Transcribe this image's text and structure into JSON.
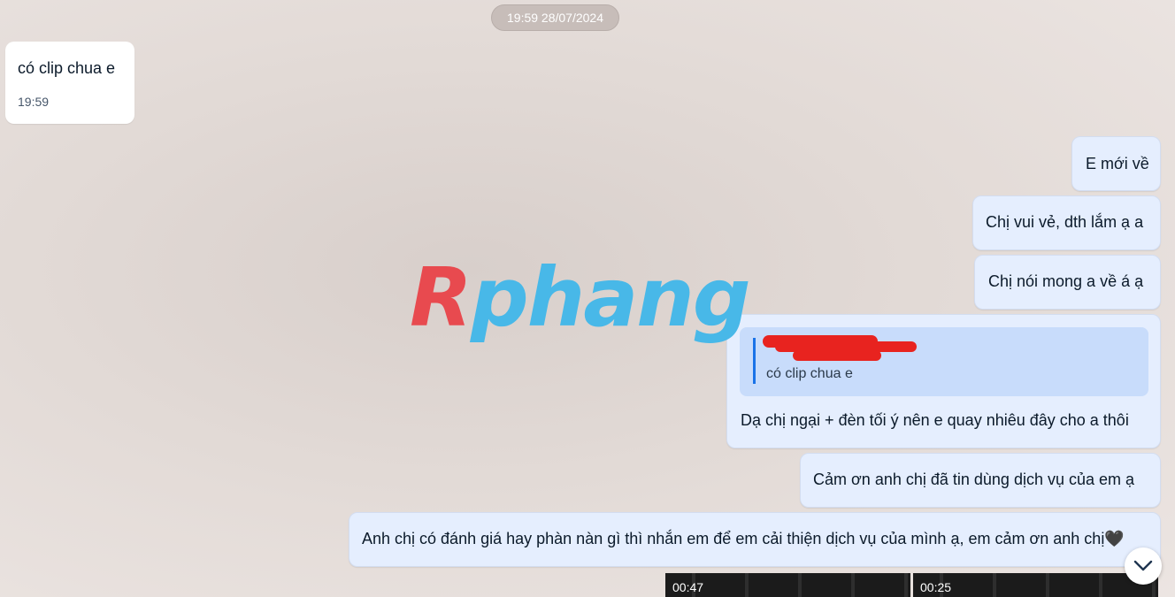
{
  "chat": {
    "date_pill": "19:59 28/07/2024",
    "incoming": [
      {
        "text": "có clip chua e",
        "time": "19:59"
      }
    ],
    "outgoing": [
      {
        "text": "E mới về"
      },
      {
        "text": "Chị vui vẻ, dth lắm ạ a"
      },
      {
        "text": "Chị nói mong a về á ạ"
      },
      {
        "text": "Dạ chị ngại + đèn tối ý nên e quay nhiêu đây cho a thôi",
        "reply_to": "có clip chua e"
      },
      {
        "text": "Cảm ơn anh chị đã tin dùng dịch vụ của em ạ"
      },
      {
        "text": "Anh chị có đánh giá hay phàn nàn gì thì nhắn em để em cải thiện dịch vụ của mình ạ, em cảm ơn anh chị🖤"
      }
    ],
    "videos": [
      {
        "duration": "00:47"
      },
      {
        "duration": "00:25"
      }
    ]
  },
  "watermark": {
    "first": "R",
    "rest": "phang"
  },
  "icons": {
    "scroll_down": "chevron-down-icon"
  },
  "colors": {
    "outgoing_bubble": "#e5eefe",
    "incoming_bubble": "#ffffff",
    "quote_accent": "#1a73e8",
    "redaction": "#e8231f"
  }
}
